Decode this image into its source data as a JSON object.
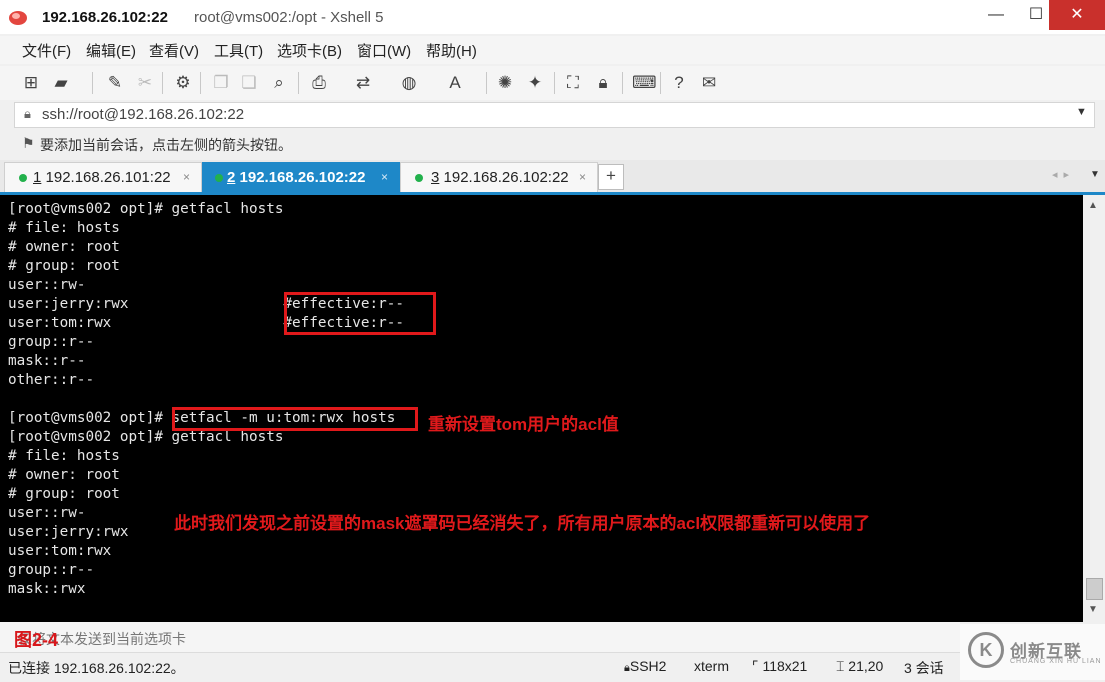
{
  "window": {
    "title_host": "192.168.26.102:22",
    "title_rest": "root@vms002:/opt - Xshell 5",
    "minimize": "—",
    "maximize": "☐",
    "close": "✕"
  },
  "menu": [
    "文件(F)",
    "编辑(E)",
    "查看(V)",
    "工具(T)",
    "选项卡(B)",
    "窗口(W)",
    "帮助(H)"
  ],
  "toolbar_icons": [
    "new-session-icon",
    "open-folder-icon",
    "connect-icon",
    "disconnect-icon",
    "properties-icon",
    "copy-icon",
    "paste-icon",
    "find-icon",
    "print-icon",
    "transfer-icon",
    "globe-icon",
    "font-icon",
    "xftp-icon",
    "xmanager-icon",
    "fullscreen-icon",
    "lock-icon",
    "keyboard-icon",
    "help-icon",
    "chat-icon"
  ],
  "address": {
    "value": "ssh://root@192.168.26.102:22"
  },
  "hint": "要添加当前会话，点击左侧的箭头按钮。",
  "tabs": [
    {
      "num": "1",
      "label": "192.168.26.101:22",
      "active": false
    },
    {
      "num": "2",
      "label": "192.168.26.102:22",
      "active": true
    },
    {
      "num": "3",
      "label": "192.168.26.102:22",
      "active": false
    }
  ],
  "tab_add": "+",
  "terminal": {
    "lines": [
      "[root@vms002 opt]# getfacl hosts",
      "# file: hosts",
      "# owner: root",
      "# group: root",
      "user::rw-",
      "user:jerry:rwx                  #effective:r--",
      "user:tom:rwx                    #effective:r--",
      "group::r--",
      "mask::r--",
      "other::r--",
      "",
      "[root@vms002 opt]# setfacl -m u:tom:rwx hosts",
      "[root@vms002 opt]# getfacl hosts",
      "# file: hosts",
      "# owner: root",
      "# group: root",
      "user::rw-",
      "user:jerry:rwx",
      "user:tom:rwx",
      "group::r--",
      "mask::rwx"
    ]
  },
  "annotations": {
    "reset_note": "重新设置tom用户的acl值",
    "mask_note": "此时我们发现之前设置的mask遮罩码已经消失了，所有用户原本的acl权限都重新可以使用了",
    "figure_label": "图2-4"
  },
  "compose_placeholder": "仅将文本发送到当前选项卡",
  "status": {
    "connection": "已连接 192.168.26.102:22。",
    "protocol": "SSH2",
    "terminal_type": "xterm",
    "size": "118x21",
    "cursor": "21,20",
    "sessions": "3 会话"
  },
  "watermark": {
    "logo": "K",
    "text": "创新互联",
    "sub": "CHUANG XIN HU LIAN"
  },
  "colors": {
    "accent": "#1e88c8",
    "annotation": "#e0191b",
    "close": "#c9302c",
    "online": "#22b14c"
  }
}
